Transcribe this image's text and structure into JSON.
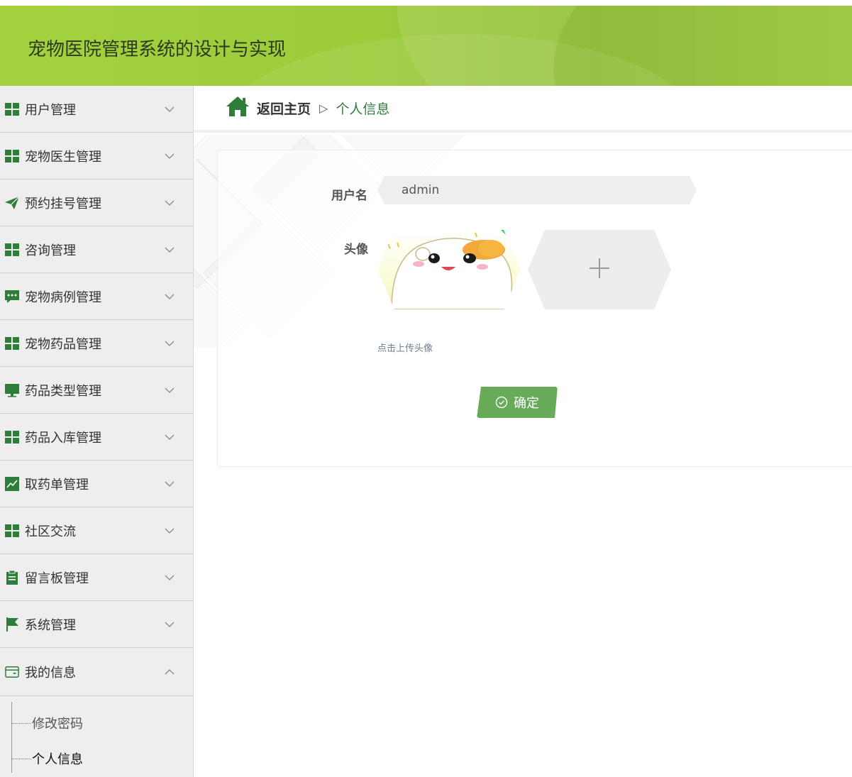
{
  "header": {
    "title": "宠物医院管理系统的设计与实现"
  },
  "sidebar": {
    "items": [
      {
        "label": "用户管理",
        "icon": "grid-icon"
      },
      {
        "label": "宠物医生管理",
        "icon": "grid-icon"
      },
      {
        "label": "预约挂号管理",
        "icon": "send-icon"
      },
      {
        "label": "咨询管理",
        "icon": "grid-icon"
      },
      {
        "label": "宠物病例管理",
        "icon": "chat-icon"
      },
      {
        "label": "宠物药品管理",
        "icon": "grid-icon"
      },
      {
        "label": "药品类型管理",
        "icon": "monitor-icon"
      },
      {
        "label": "药品入库管理",
        "icon": "grid-icon"
      },
      {
        "label": "取药单管理",
        "icon": "chart-icon"
      },
      {
        "label": "社区交流",
        "icon": "grid-icon"
      },
      {
        "label": "留言板管理",
        "icon": "clipboard-icon"
      },
      {
        "label": "系统管理",
        "icon": "flag-icon"
      },
      {
        "label": "我的信息",
        "icon": "wallet-icon",
        "expanded": true
      }
    ],
    "submenu": [
      {
        "label": "修改密码"
      },
      {
        "label": "个人信息",
        "active": true
      }
    ]
  },
  "breadcrumb": {
    "home": "返回主页",
    "separator": "▷",
    "current": "个人信息"
  },
  "form": {
    "username_label": "用户名",
    "username_value": "admin",
    "avatar_label": "头像",
    "upload_hint": "点击上传头像",
    "submit_label": "确定"
  },
  "colors": {
    "accent": "#67ab58",
    "brand_green": "#2f7d3b",
    "header_green": "#a4d23f"
  }
}
